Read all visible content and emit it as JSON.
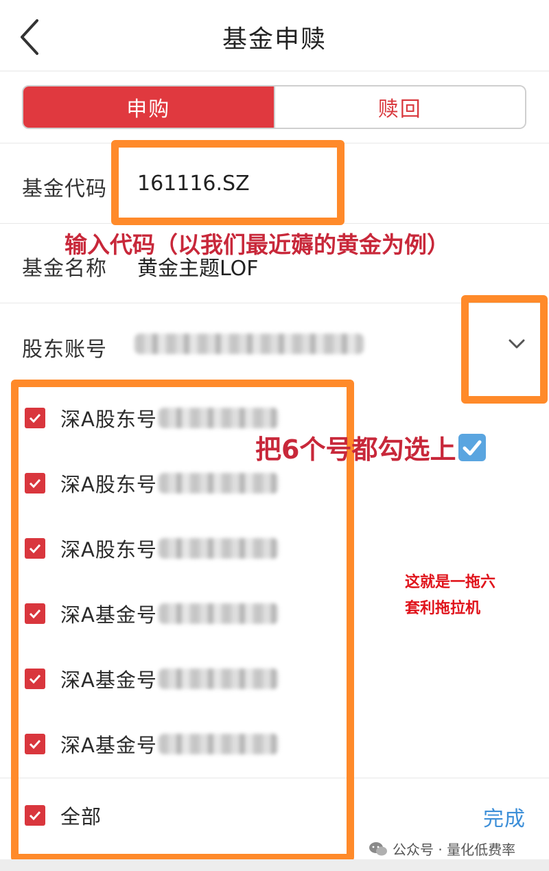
{
  "header": {
    "title": "基金申赎"
  },
  "tabs": [
    {
      "label": "申购",
      "active": true
    },
    {
      "label": "赎回",
      "active": false
    }
  ],
  "form": {
    "fund_code_label": "基金代码",
    "fund_code_value": "161116.SZ",
    "fund_name_label": "基金名称",
    "fund_name_value": "黄金主题LOF",
    "shareholder_label": "股东账号"
  },
  "accounts": [
    {
      "label": "深A股东号",
      "checked": true
    },
    {
      "label": "深A股东号",
      "checked": true
    },
    {
      "label": "深A股东号",
      "checked": true
    },
    {
      "label": "深A基金号",
      "checked": true
    },
    {
      "label": "深A基金号",
      "checked": true
    },
    {
      "label": "深A基金号",
      "checked": true
    }
  ],
  "footer": {
    "all_label": "全部",
    "all_checked": true,
    "done_label": "完成"
  },
  "annotations": {
    "input_code": "输入代码（以我们最近薅的黄金为例）",
    "check_all": "把6个号都勾选上",
    "note_line1": "这就是一拖六",
    "note_line2": "套利拖拉机"
  },
  "watermark": "公众号 · 量化低费率",
  "colors": {
    "accent_red": "#e0393f",
    "annotation_orange": "#ff8a2a",
    "link_blue": "#3d8fd8"
  }
}
